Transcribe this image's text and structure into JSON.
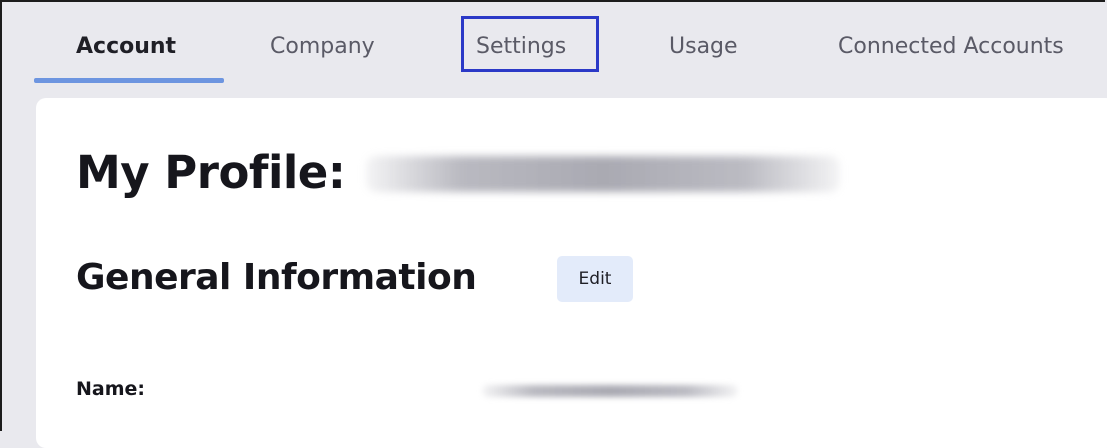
{
  "tabs": [
    {
      "label": "Account",
      "active": true
    },
    {
      "label": "Company",
      "active": false
    },
    {
      "label": "Settings",
      "active": false,
      "highlighted": true
    },
    {
      "label": "Usage",
      "active": false
    },
    {
      "label": "Connected Accounts",
      "active": false
    }
  ],
  "profile": {
    "title_prefix": "My Profile:"
  },
  "general_info": {
    "title": "General Information",
    "edit_label": "Edit"
  },
  "fields": [
    {
      "label": "Name:"
    }
  ],
  "colors": {
    "accent": "#6d95e0",
    "highlight_box": "#2b39c7",
    "edit_button_bg": "#e3ebfa",
    "background": "#e9e9ee"
  }
}
